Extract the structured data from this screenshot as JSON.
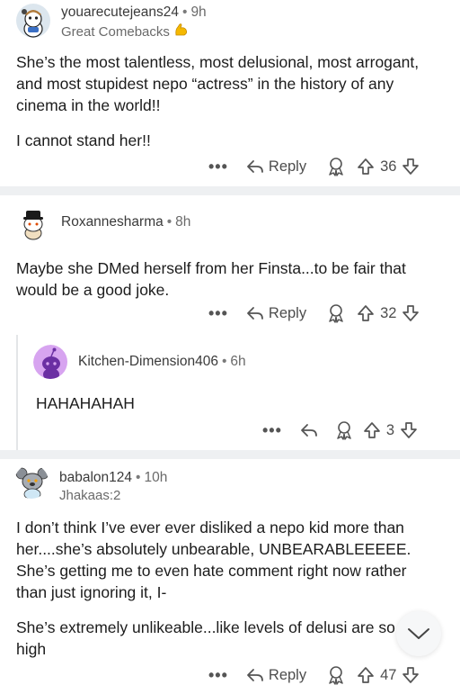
{
  "comments": [
    {
      "username": "youarecutejeans24",
      "time": "9h",
      "flair": "Great Comebacks",
      "paragraphs": [
        "She’s the most talentless, most delusional, most arrogant, and most stupidest nepo “actress” in the history of any cinema in the world!!",
        "I cannot stand her!!"
      ],
      "reply_label": "Reply",
      "votes": "36"
    },
    {
      "username": "Roxannesharma",
      "time": "8h",
      "paragraphs": [
        "Maybe she DMed herself from her Finsta...to be fair that would be a good joke."
      ],
      "reply_label": "Reply",
      "votes": "32"
    },
    {
      "username": "Kitchen-Dimension406",
      "time": "6h",
      "paragraphs": [
        "HAHAHAHAH"
      ],
      "votes": "3"
    },
    {
      "username": "babalon124",
      "time": "10h",
      "flair": "Jhakaas:2",
      "paragraphs": [
        "I don’t think I’ve ever ever disliked a nepo kid more than her....she’s absolutely unbearable, UNBEARABLEEEEE. She’s getting me to even hate comment right now rather than just ignoring it, I-",
        "She’s extremely unlikeable...like levels of delusi are so high"
      ],
      "reply_label": "Reply",
      "votes": "47"
    }
  ],
  "separator": "•",
  "more_label": "•••",
  "icons": {
    "more": "more-options-icon",
    "reply": "reply-arrow-icon",
    "award": "award-icon",
    "upvote": "upvote-arrow-icon",
    "downvote": "downvote-arrow-icon",
    "expand": "chevron-down-icon"
  },
  "colors": {
    "divider": "#eef0f2",
    "flair_emoji": "#f5b800",
    "kitchen_avatar_bg": "#d7a4f0"
  }
}
